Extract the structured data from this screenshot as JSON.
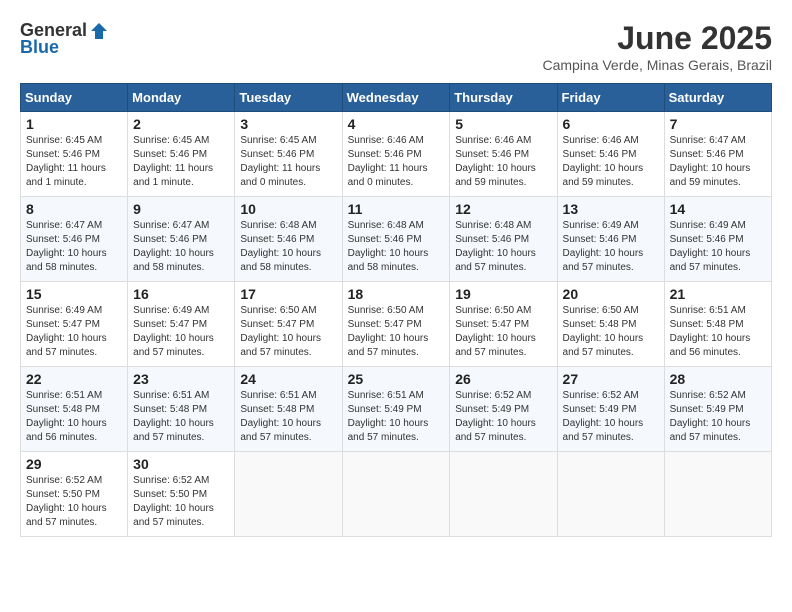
{
  "header": {
    "logo_general": "General",
    "logo_blue": "Blue",
    "title": "June 2025",
    "subtitle": "Campina Verde, Minas Gerais, Brazil"
  },
  "columns": [
    "Sunday",
    "Monday",
    "Tuesday",
    "Wednesday",
    "Thursday",
    "Friday",
    "Saturday"
  ],
  "weeks": [
    [
      {
        "day": "1",
        "info": "Sunrise: 6:45 AM\nSunset: 5:46 PM\nDaylight: 11 hours and 1 minute."
      },
      {
        "day": "2",
        "info": "Sunrise: 6:45 AM\nSunset: 5:46 PM\nDaylight: 11 hours and 1 minute."
      },
      {
        "day": "3",
        "info": "Sunrise: 6:45 AM\nSunset: 5:46 PM\nDaylight: 11 hours and 0 minutes."
      },
      {
        "day": "4",
        "info": "Sunrise: 6:46 AM\nSunset: 5:46 PM\nDaylight: 11 hours and 0 minutes."
      },
      {
        "day": "5",
        "info": "Sunrise: 6:46 AM\nSunset: 5:46 PM\nDaylight: 10 hours and 59 minutes."
      },
      {
        "day": "6",
        "info": "Sunrise: 6:46 AM\nSunset: 5:46 PM\nDaylight: 10 hours and 59 minutes."
      },
      {
        "day": "7",
        "info": "Sunrise: 6:47 AM\nSunset: 5:46 PM\nDaylight: 10 hours and 59 minutes."
      }
    ],
    [
      {
        "day": "8",
        "info": "Sunrise: 6:47 AM\nSunset: 5:46 PM\nDaylight: 10 hours and 58 minutes."
      },
      {
        "day": "9",
        "info": "Sunrise: 6:47 AM\nSunset: 5:46 PM\nDaylight: 10 hours and 58 minutes."
      },
      {
        "day": "10",
        "info": "Sunrise: 6:48 AM\nSunset: 5:46 PM\nDaylight: 10 hours and 58 minutes."
      },
      {
        "day": "11",
        "info": "Sunrise: 6:48 AM\nSunset: 5:46 PM\nDaylight: 10 hours and 58 minutes."
      },
      {
        "day": "12",
        "info": "Sunrise: 6:48 AM\nSunset: 5:46 PM\nDaylight: 10 hours and 57 minutes."
      },
      {
        "day": "13",
        "info": "Sunrise: 6:49 AM\nSunset: 5:46 PM\nDaylight: 10 hours and 57 minutes."
      },
      {
        "day": "14",
        "info": "Sunrise: 6:49 AM\nSunset: 5:46 PM\nDaylight: 10 hours and 57 minutes."
      }
    ],
    [
      {
        "day": "15",
        "info": "Sunrise: 6:49 AM\nSunset: 5:47 PM\nDaylight: 10 hours and 57 minutes."
      },
      {
        "day": "16",
        "info": "Sunrise: 6:49 AM\nSunset: 5:47 PM\nDaylight: 10 hours and 57 minutes."
      },
      {
        "day": "17",
        "info": "Sunrise: 6:50 AM\nSunset: 5:47 PM\nDaylight: 10 hours and 57 minutes."
      },
      {
        "day": "18",
        "info": "Sunrise: 6:50 AM\nSunset: 5:47 PM\nDaylight: 10 hours and 57 minutes."
      },
      {
        "day": "19",
        "info": "Sunrise: 6:50 AM\nSunset: 5:47 PM\nDaylight: 10 hours and 57 minutes."
      },
      {
        "day": "20",
        "info": "Sunrise: 6:50 AM\nSunset: 5:48 PM\nDaylight: 10 hours and 57 minutes."
      },
      {
        "day": "21",
        "info": "Sunrise: 6:51 AM\nSunset: 5:48 PM\nDaylight: 10 hours and 56 minutes."
      }
    ],
    [
      {
        "day": "22",
        "info": "Sunrise: 6:51 AM\nSunset: 5:48 PM\nDaylight: 10 hours and 56 minutes."
      },
      {
        "day": "23",
        "info": "Sunrise: 6:51 AM\nSunset: 5:48 PM\nDaylight: 10 hours and 57 minutes."
      },
      {
        "day": "24",
        "info": "Sunrise: 6:51 AM\nSunset: 5:48 PM\nDaylight: 10 hours and 57 minutes."
      },
      {
        "day": "25",
        "info": "Sunrise: 6:51 AM\nSunset: 5:49 PM\nDaylight: 10 hours and 57 minutes."
      },
      {
        "day": "26",
        "info": "Sunrise: 6:52 AM\nSunset: 5:49 PM\nDaylight: 10 hours and 57 minutes."
      },
      {
        "day": "27",
        "info": "Sunrise: 6:52 AM\nSunset: 5:49 PM\nDaylight: 10 hours and 57 minutes."
      },
      {
        "day": "28",
        "info": "Sunrise: 6:52 AM\nSunset: 5:49 PM\nDaylight: 10 hours and 57 minutes."
      }
    ],
    [
      {
        "day": "29",
        "info": "Sunrise: 6:52 AM\nSunset: 5:50 PM\nDaylight: 10 hours and 57 minutes."
      },
      {
        "day": "30",
        "info": "Sunrise: 6:52 AM\nSunset: 5:50 PM\nDaylight: 10 hours and 57 minutes."
      },
      {
        "day": "",
        "info": ""
      },
      {
        "day": "",
        "info": ""
      },
      {
        "day": "",
        "info": ""
      },
      {
        "day": "",
        "info": ""
      },
      {
        "day": "",
        "info": ""
      }
    ]
  ]
}
